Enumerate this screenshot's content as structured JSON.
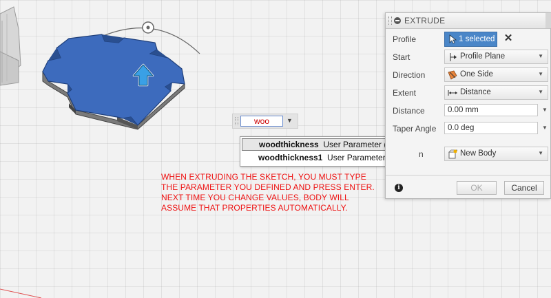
{
  "autocomplete": {
    "items": [
      {
        "name": "woodthickness",
        "type": "User Parameter (mm)"
      },
      {
        "name": "woodthickness1",
        "type": "User Parameter (mm)"
      }
    ]
  },
  "annotation": {
    "lines": [
      "WHEN EXTRUDING THE SKETCH, YOU MUST TYPE",
      "THE PARAMETER YOU DEFINED AND PRESS ENTER.",
      "NEXT TIME YOU CHANGE VALUES, BODY WILL",
      "ASSUME THAT PROPERTIES AUTOMATICALLY."
    ]
  },
  "panel": {
    "title": "EXTRUDE",
    "profile": {
      "label": "Profile",
      "value": "1 selected"
    },
    "start": {
      "label": "Start",
      "value": "Profile Plane"
    },
    "direction": {
      "label": "Direction",
      "value": "One Side"
    },
    "extent": {
      "label": "Extent",
      "value": "Distance"
    },
    "distance": {
      "label": "Distance",
      "value": "0.00 mm"
    },
    "taper": {
      "label": "Taper Angle",
      "value": "0.0 deg"
    },
    "operation": {
      "label": "n",
      "value": "New Body"
    },
    "ok": "OK",
    "cancel": "Cancel"
  },
  "colors": {
    "body": "#3d6bbd",
    "annotation": "#ee1111",
    "accent": "#4a86c8"
  },
  "value_input": "woo"
}
